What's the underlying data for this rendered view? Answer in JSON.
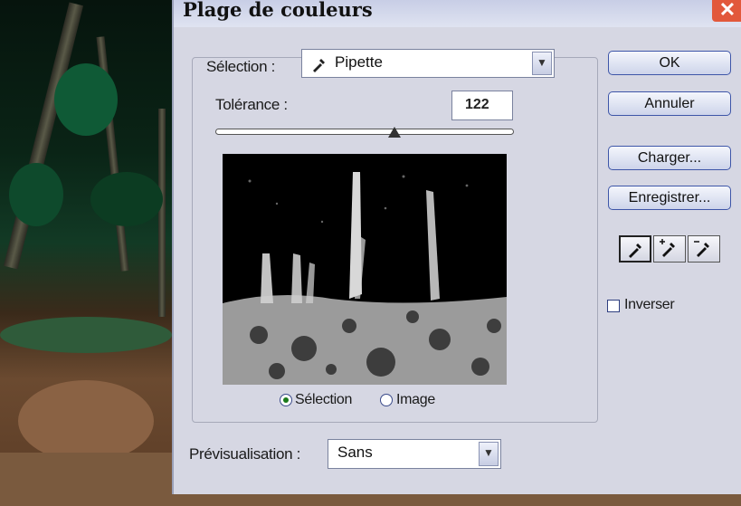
{
  "dialog": {
    "title": "Plage de couleurs",
    "selection_label": "Sélection :",
    "selection_value": "Pipette",
    "tolerance_label": "Tolérance :",
    "tolerance_value": "122",
    "tolerance_fraction": 0.6,
    "radio_selection": "Sélection",
    "radio_image": "Image",
    "preview_label": "Prévisualisation :",
    "preview_value": "Sans",
    "ok": "OK",
    "cancel": "Annuler",
    "load": "Charger...",
    "save": "Enregistrer...",
    "invert": "Inverser",
    "invert_checked": false,
    "selected_radio": "selection"
  },
  "icons": {
    "close": "close-icon",
    "eyedropper": "eyedropper-icon",
    "eyedropper_plus": "eyedropper-plus-icon",
    "eyedropper_minus": "eyedropper-minus-icon",
    "dropdown": "chevron-down-icon"
  },
  "colors": {
    "close": "#e2583b",
    "dialog_bg": "#d6d7e3",
    "button_border": "#3e56a8"
  }
}
